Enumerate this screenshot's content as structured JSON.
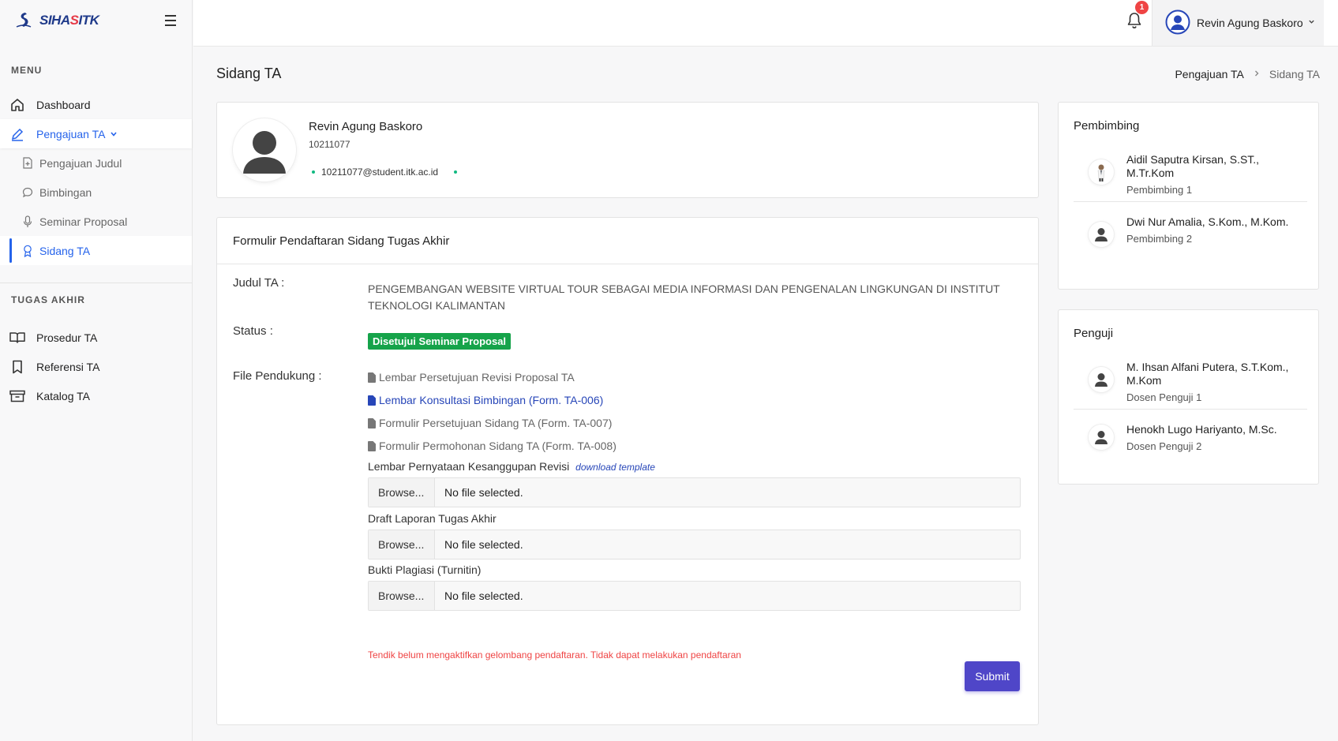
{
  "app": {
    "logo_text_a": "SIHA",
    "logo_text_b": "S",
    "logo_text_c": "ITK"
  },
  "sidebar": {
    "menu_title": "MENU",
    "items": [
      {
        "label": "Dashboard",
        "icon": "home-icon"
      },
      {
        "label": "Pengajuan TA",
        "icon": "pen-icon"
      }
    ],
    "sub_items": [
      {
        "label": "Pengajuan Judul",
        "icon": "file-plus-icon"
      },
      {
        "label": "Bimbingan",
        "icon": "chat-icon"
      },
      {
        "label": "Seminar Proposal",
        "icon": "mic-icon"
      },
      {
        "label": "Sidang TA",
        "icon": "award-icon"
      }
    ],
    "ta_title": "TUGAS AKHIR",
    "ta_items": [
      {
        "label": "Prosedur TA",
        "icon": "book-icon"
      },
      {
        "label": "Referensi TA",
        "icon": "bookmark-icon"
      },
      {
        "label": "Katalog TA",
        "icon": "archive-icon"
      }
    ]
  },
  "header": {
    "notification_count": "1",
    "user_name": "Revin Agung Baskoro"
  },
  "page": {
    "title": "Sidang TA",
    "breadcrumb": [
      "Pengajuan TA",
      "Sidang TA"
    ]
  },
  "profile": {
    "name": "Revin Agung Baskoro",
    "nim": "10211077",
    "email": "10211077@student.itk.ac.id"
  },
  "form": {
    "title": "Formulir Pendaftaran Sidang Tugas Akhir",
    "judul_label": "Judul TA :",
    "judul_value": "PENGEMBANGAN WEBSITE VIRTUAL TOUR SEBAGAI MEDIA INFORMASI DAN PENGENALAN LINGKUNGAN DI INSTITUT TEKNOLOGI KALIMANTAN",
    "status_label": "Status :",
    "status_value": "Disetujui Seminar Proposal",
    "status_color": "#16a34a",
    "files_label": "File Pendukung :",
    "files": [
      "Lembar Persetujuan Revisi Proposal TA",
      "Lembar Konsultasi Bimbingan (Form. TA-006)",
      "Formulir Persetujuan Sidang TA (Form. TA-007)",
      "Formulir Permohonan Sidang TA (Form. TA-008)"
    ],
    "uploads": [
      {
        "label": "Lembar Pernyataan Kesanggupan Revisi",
        "link": "download template",
        "browse": "Browse...",
        "value": "No file selected."
      },
      {
        "label": "Draft Laporan Tugas Akhir",
        "browse": "Browse...",
        "value": "No file selected."
      },
      {
        "label": "Bukti Plagiasi (Turnitin)",
        "browse": "Browse...",
        "value": "No file selected."
      }
    ],
    "warning": "Tendik belum mengaktifkan gelombang pendaftaran. Tidak dapat melakukan pendaftaran",
    "submit_label": "Submit",
    "accent": "#4f46c8"
  },
  "pembimbing": {
    "title": "Pembimbing",
    "people": [
      {
        "name": "Aidil Saputra Kirsan, S.ST., M.Tr.Kom",
        "role": "Pembimbing 1"
      },
      {
        "name": "Dwi Nur Amalia, S.Kom., M.Kom.",
        "role": "Pembimbing 2"
      }
    ]
  },
  "penguji": {
    "title": "Penguji",
    "people": [
      {
        "name": "M. Ihsan Alfani Putera, S.T.Kom., M.Kom",
        "role": "Dosen Penguji 1"
      },
      {
        "name": "Henokh Lugo Hariyanto, M.Sc.",
        "role": "Dosen Penguji 2"
      }
    ]
  }
}
